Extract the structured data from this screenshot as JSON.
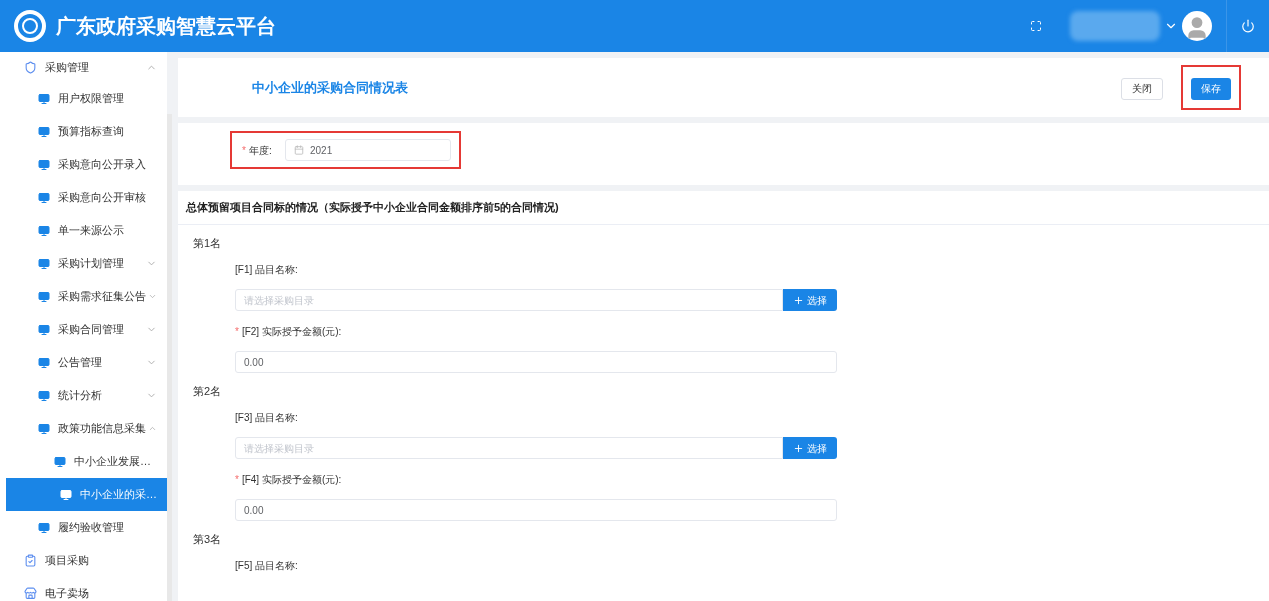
{
  "header": {
    "title": "广东政府采购智慧云平台"
  },
  "sidebar": {
    "items": [
      {
        "label": "采购管理",
        "kind": "shield",
        "expanded": true,
        "selected": false,
        "children": [
          {
            "label": "用户权限管理",
            "selected": false
          },
          {
            "label": "预算指标查询",
            "selected": false
          },
          {
            "label": "采购意向公开录入",
            "selected": false
          },
          {
            "label": "采购意向公开审核",
            "selected": false
          },
          {
            "label": "单一来源公示",
            "selected": false
          },
          {
            "label": "采购计划管理",
            "expanded": false,
            "selected": false
          },
          {
            "label": "采购需求征集公告",
            "expanded": false,
            "selected": false
          },
          {
            "label": "采购合同管理",
            "expanded": false,
            "selected": false
          },
          {
            "label": "公告管理",
            "expanded": false,
            "selected": false
          },
          {
            "label": "统计分析",
            "expanded": false,
            "selected": false
          },
          {
            "label": "政策功能信息采集",
            "expanded": true,
            "selected": false,
            "children": [
              {
                "label": "中小企业发展…",
                "selected": false
              },
              {
                "label": "中小企业的采…",
                "selected": true
              }
            ]
          },
          {
            "label": "履约验收管理",
            "selected": false
          }
        ]
      },
      {
        "label": "项目采购",
        "kind": "clipboard",
        "selected": false
      },
      {
        "label": "电子卖场",
        "kind": "shop",
        "selected": false
      }
    ]
  },
  "page": {
    "title": "中小企业的采购合同情况表",
    "buttons": [
      {
        "label": "关闭",
        "kind": "default",
        "highlighted": false
      },
      {
        "label": "保存",
        "kind": "primary",
        "highlighted": true
      }
    ]
  },
  "year_field": {
    "label": "年度:",
    "required_mark": "*",
    "value": "2021",
    "highlighted": true
  },
  "section": {
    "title": "总体预留项目合同标的情况（实际授予中小企业合同金额排序前5的合同情况)",
    "ranks": [
      {
        "title": "第1名",
        "fields": [
          {
            "label": "[F1] 品目名称:",
            "kind": "select",
            "placeholder": "请选择采购目录",
            "button": "选择"
          },
          {
            "label": "[F2] 实际授予金额(元):",
            "required_mark": "*",
            "kind": "amount",
            "value": "0.00"
          }
        ]
      },
      {
        "title": "第2名",
        "fields": [
          {
            "label": "[F3] 品目名称:",
            "kind": "select",
            "placeholder": "请选择采购目录",
            "button": "选择"
          },
          {
            "label": "[F4] 实际授予金额(元):",
            "required_mark": "*",
            "kind": "amount",
            "value": "0.00"
          }
        ]
      },
      {
        "title": "第3名",
        "fields": [
          {
            "label": "[F5] 品目名称:",
            "kind": "label_only"
          }
        ]
      }
    ]
  }
}
